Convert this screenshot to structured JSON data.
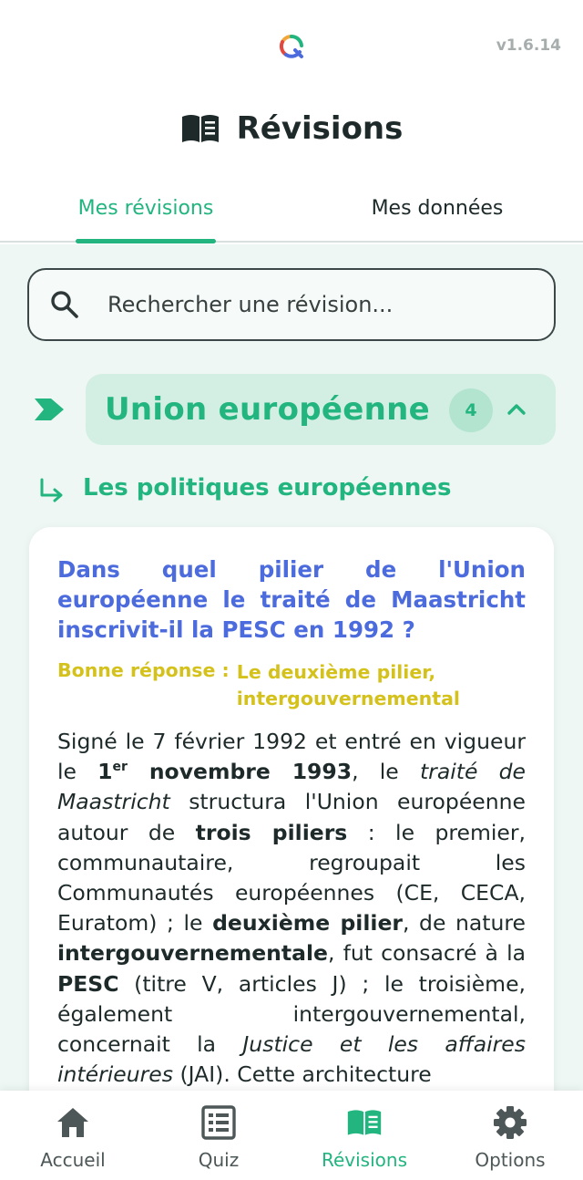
{
  "app": {
    "version": "v1.6.14",
    "logo_icon": "app-logo-icon"
  },
  "header": {
    "title": "Révisions",
    "title_icon": "book-icon"
  },
  "tabs": [
    {
      "label": "Mes révisions",
      "active": true
    },
    {
      "label": "Mes données",
      "active": false
    }
  ],
  "search": {
    "placeholder": "Rechercher une révision..."
  },
  "category": {
    "title": "Union européenne",
    "count": "4",
    "expanded": true
  },
  "subcategory": {
    "title": "Les politiques européennes"
  },
  "card": {
    "question": "Dans quel pilier de l'Union européenne le traité de Maastricht inscrivit-il la PESC en 1992 ?",
    "answer_label": "Bonne réponse :",
    "answer_value": "Le deuxième pilier, intergouvernemental",
    "explanation": [
      {
        "t": "Signé le 7 février 1992 et entré en vigueur le "
      },
      {
        "t": "1",
        "b": true
      },
      {
        "t": "er",
        "b": true,
        "sup": true
      },
      {
        "t": " novembre 1993",
        "b": true
      },
      {
        "t": ", le "
      },
      {
        "t": "traité de Maastricht",
        "i": true
      },
      {
        "t": " structura l'Union européenne autour de "
      },
      {
        "t": "trois piliers",
        "b": true
      },
      {
        "t": " : le premier, communautaire, regroupait les Communautés européennes (CE, CECA, Euratom) ; le "
      },
      {
        "t": "deuxième pilier",
        "b": true
      },
      {
        "t": ", de nature "
      },
      {
        "t": "intergouvernementale",
        "b": true
      },
      {
        "t": ", fut consacré à la "
      },
      {
        "t": "PESC",
        "b": true
      },
      {
        "t": " (titre V, articles J) ; le troisième, également intergouvernemental, concernait la "
      },
      {
        "t": "Justice et les affaires intérieures",
        "i": true
      },
      {
        "t": " (JAI). Cette architecture"
      }
    ]
  },
  "bottom_nav": [
    {
      "label": "Accueil",
      "icon": "home-icon",
      "active": false
    },
    {
      "label": "Quiz",
      "icon": "list-icon",
      "active": false
    },
    {
      "label": "Révisions",
      "icon": "book-icon",
      "active": true
    },
    {
      "label": "Options",
      "icon": "gear-icon",
      "active": false
    }
  ],
  "colors": {
    "accent": "#22b57f",
    "question": "#4c6bdc",
    "answer": "#d4c11b",
    "background_content": "#eef7f4"
  }
}
